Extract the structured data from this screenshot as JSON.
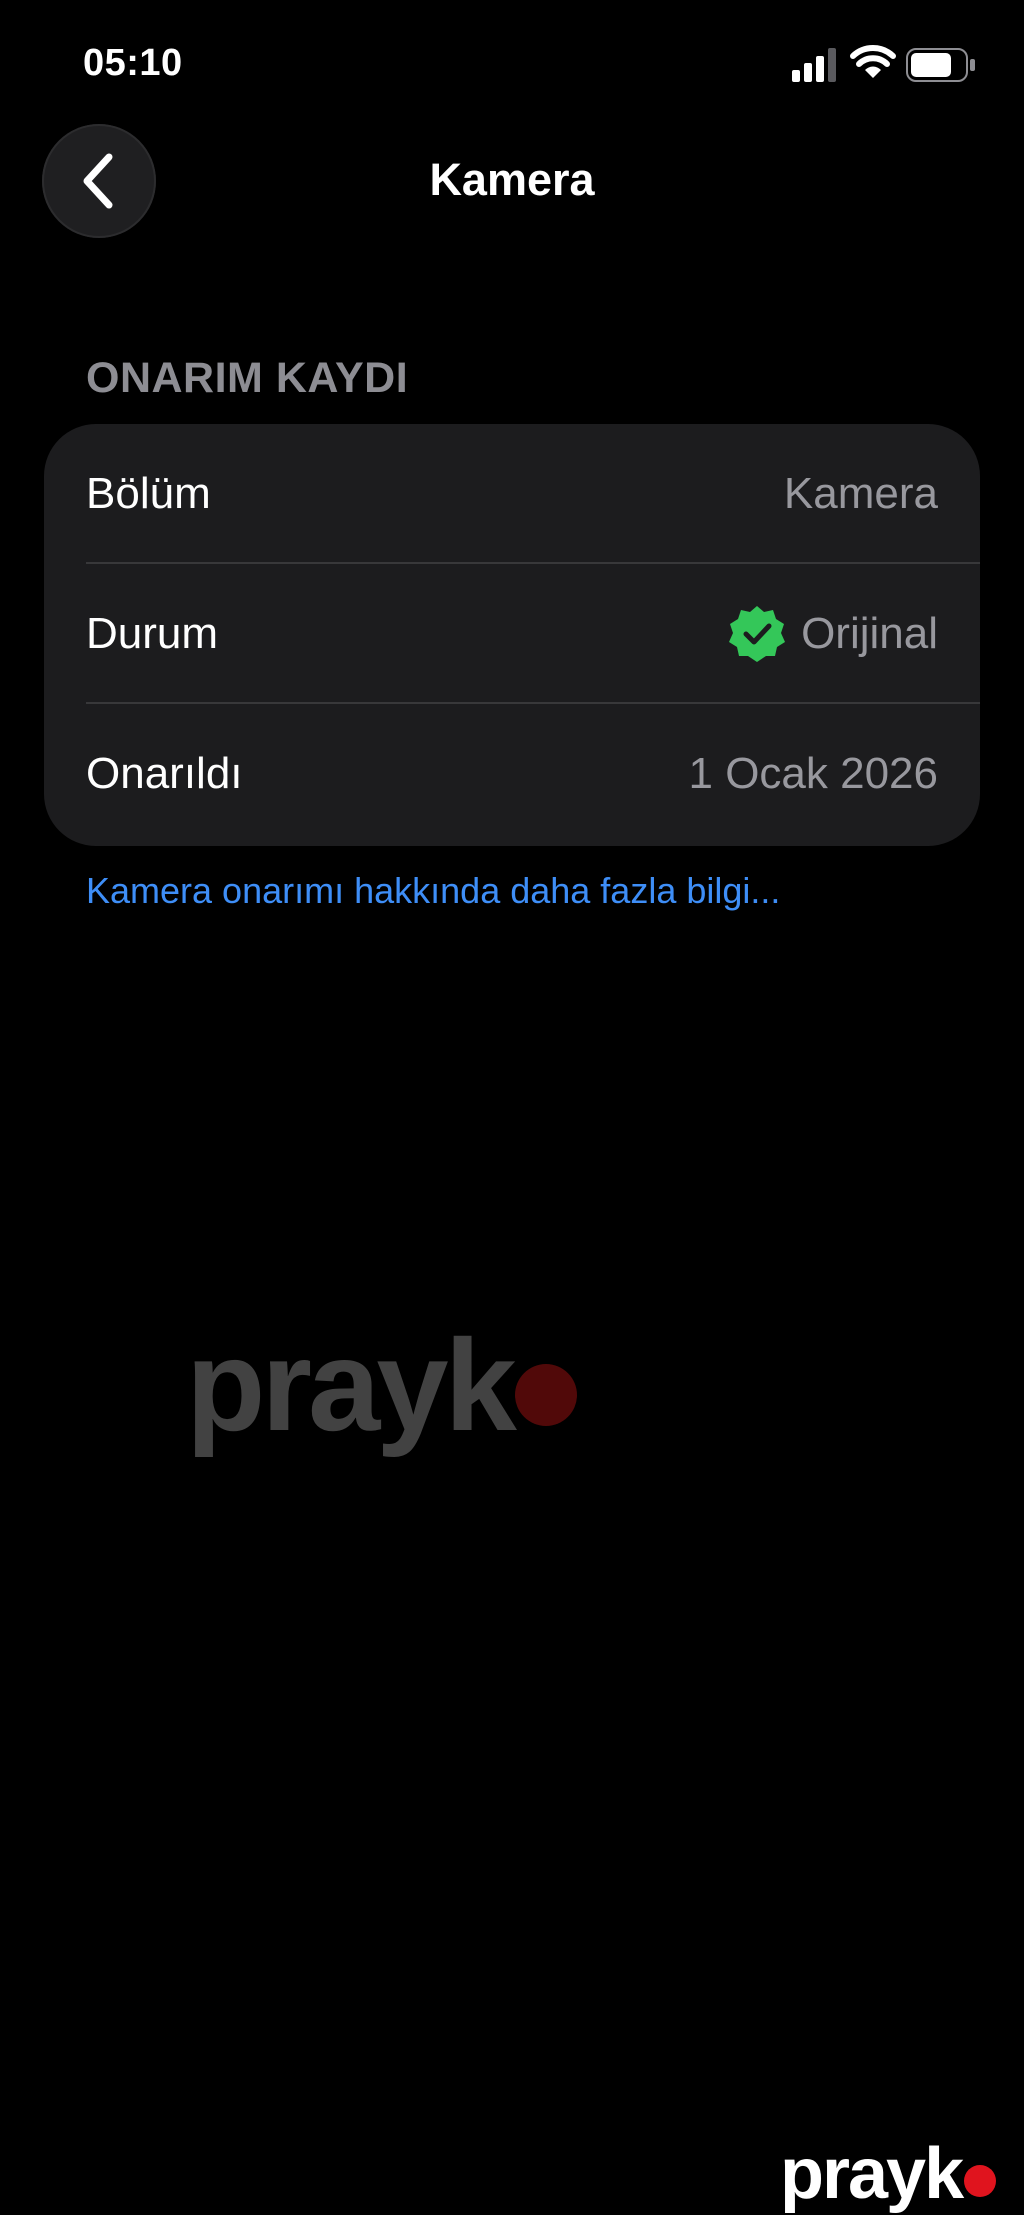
{
  "status_bar": {
    "time": "05:10",
    "signal_icon": "cellular-signal-icon",
    "wifi_icon": "wifi-icon",
    "battery_icon": "battery-icon"
  },
  "nav": {
    "back_icon": "chevron-left-icon",
    "title": "Kamera"
  },
  "section": {
    "header": "ONARIM KAYDI"
  },
  "rows": [
    {
      "label": "Bölüm",
      "value": "Kamera"
    },
    {
      "label": "Durum",
      "value": "Orijinal",
      "icon": "verified-check-icon",
      "icon_color": "#34c759"
    },
    {
      "label": "Onarıldı",
      "value": "1 Ocak 2026"
    }
  ],
  "link": {
    "text": "Kamera onarımı hakkında daha fazla bilgi..."
  },
  "watermark": {
    "text": "prayk",
    "accent_color": "#e0141e"
  },
  "colors": {
    "background": "#000000",
    "card": "#1c1c1e",
    "link": "#3e8ef7",
    "secondary_text": "#98989e",
    "header_text": "#8d8d93"
  }
}
